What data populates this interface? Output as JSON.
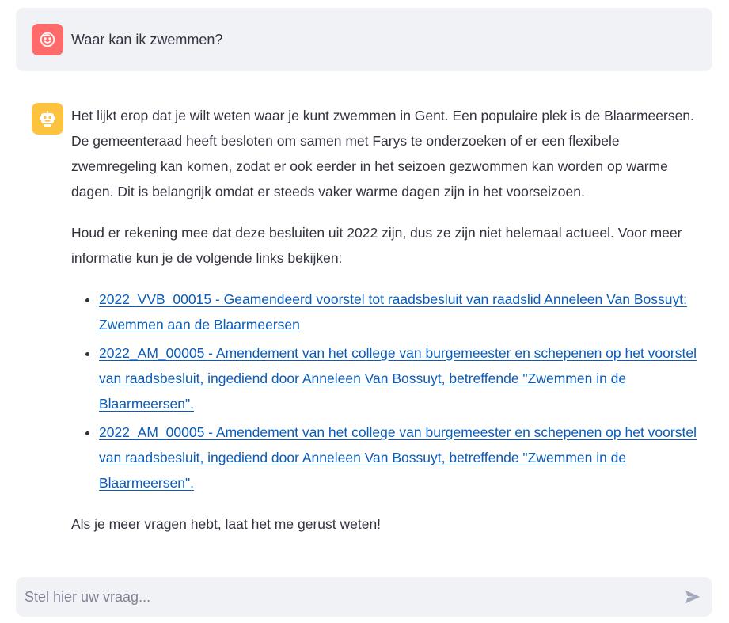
{
  "conversation": {
    "user_message": "Waar kan ik zwemmen?",
    "assistant": {
      "paragraph_1": "Het lijkt erop dat je wilt weten waar je kunt zwemmen in Gent. Een populaire plek is de Blaarmeersen. De gemeenteraad heeft besloten om samen met Farys te onderzoeken of er een flexibele zwemregeling kan komen, zodat er ook eerder in het seizoen gezwommen kan worden op warme dagen. Dit is belangrijk omdat er steeds vaker warme dagen zijn in het voorseizoen.",
      "paragraph_2": "Houd er rekening mee dat deze besluiten uit 2022 zijn, dus ze zijn niet helemaal actueel. Voor meer informatie kun je de volgende links bekijken:",
      "links": [
        "2022_VVB_00015 - Geamendeerd voorstel tot raadsbesluit van raadslid Anneleen Van Bossuyt: Zwemmen aan de Blaarmeersen",
        "2022_AM_00005 - Amendement van het college van burgemeester en schepenen op het voorstel van raadsbesluit, ingediend door Anneleen Van Bossuyt, betreffende \"Zwemmen in de Blaarmeersen\".",
        "2022_AM_00005 - Amendement van het college van burgemeester en schepenen op het voorstel van raadsbesluit, ingediend door Anneleen Van Bossuyt, betreffende \"Zwemmen in de Blaarmeersen\"."
      ],
      "closing": "Als je meer vragen hebt, laat het me gerust weten!"
    }
  },
  "input": {
    "placeholder": "Stel hier uw vraag..."
  },
  "icons": {
    "user_avatar": "smiley-face-icon",
    "assistant_avatar": "robot-icon",
    "send": "send-icon"
  },
  "colors": {
    "user_avatar_bg": "#ff6b6b",
    "assistant_avatar_bg": "#fdc33f",
    "link": "#0a5cb8",
    "bubble_bg": "#f0f2f6"
  }
}
